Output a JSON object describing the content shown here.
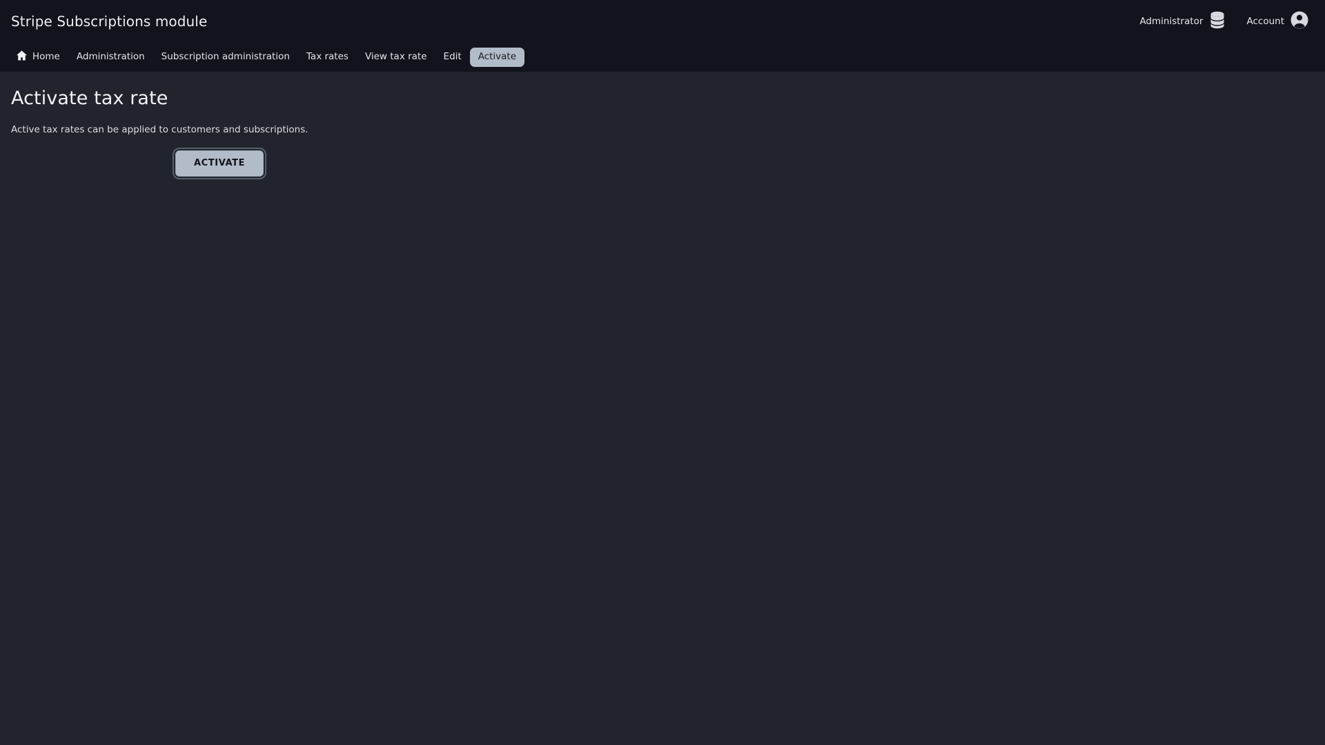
{
  "header": {
    "app_title": "Stripe Subscriptions module",
    "role": {
      "label": "Administrator",
      "icon": "database-icon"
    },
    "account": {
      "label": "Account",
      "icon": "user-avatar-icon"
    }
  },
  "nav": {
    "home_icon": "home-icon",
    "items": [
      {
        "label": "Home",
        "active": false,
        "icon": "home-icon"
      },
      {
        "label": "Administration",
        "active": false
      },
      {
        "label": "Subscription administration",
        "active": false
      },
      {
        "label": "Tax rates",
        "active": false
      },
      {
        "label": "View tax rate",
        "active": false
      },
      {
        "label": "Edit",
        "active": false
      },
      {
        "label": "Activate",
        "active": true
      }
    ]
  },
  "main": {
    "title": "Activate tax rate",
    "description": "Active tax rates can be applied to customers and subscriptions.",
    "activate_button": "ACTIVATE"
  },
  "colors": {
    "header_bg": "#12131c",
    "content_bg": "#22242d",
    "accent_light": "#b2bcc8",
    "text_primary": "#e8eaef",
    "button_text": "#11131a"
  }
}
